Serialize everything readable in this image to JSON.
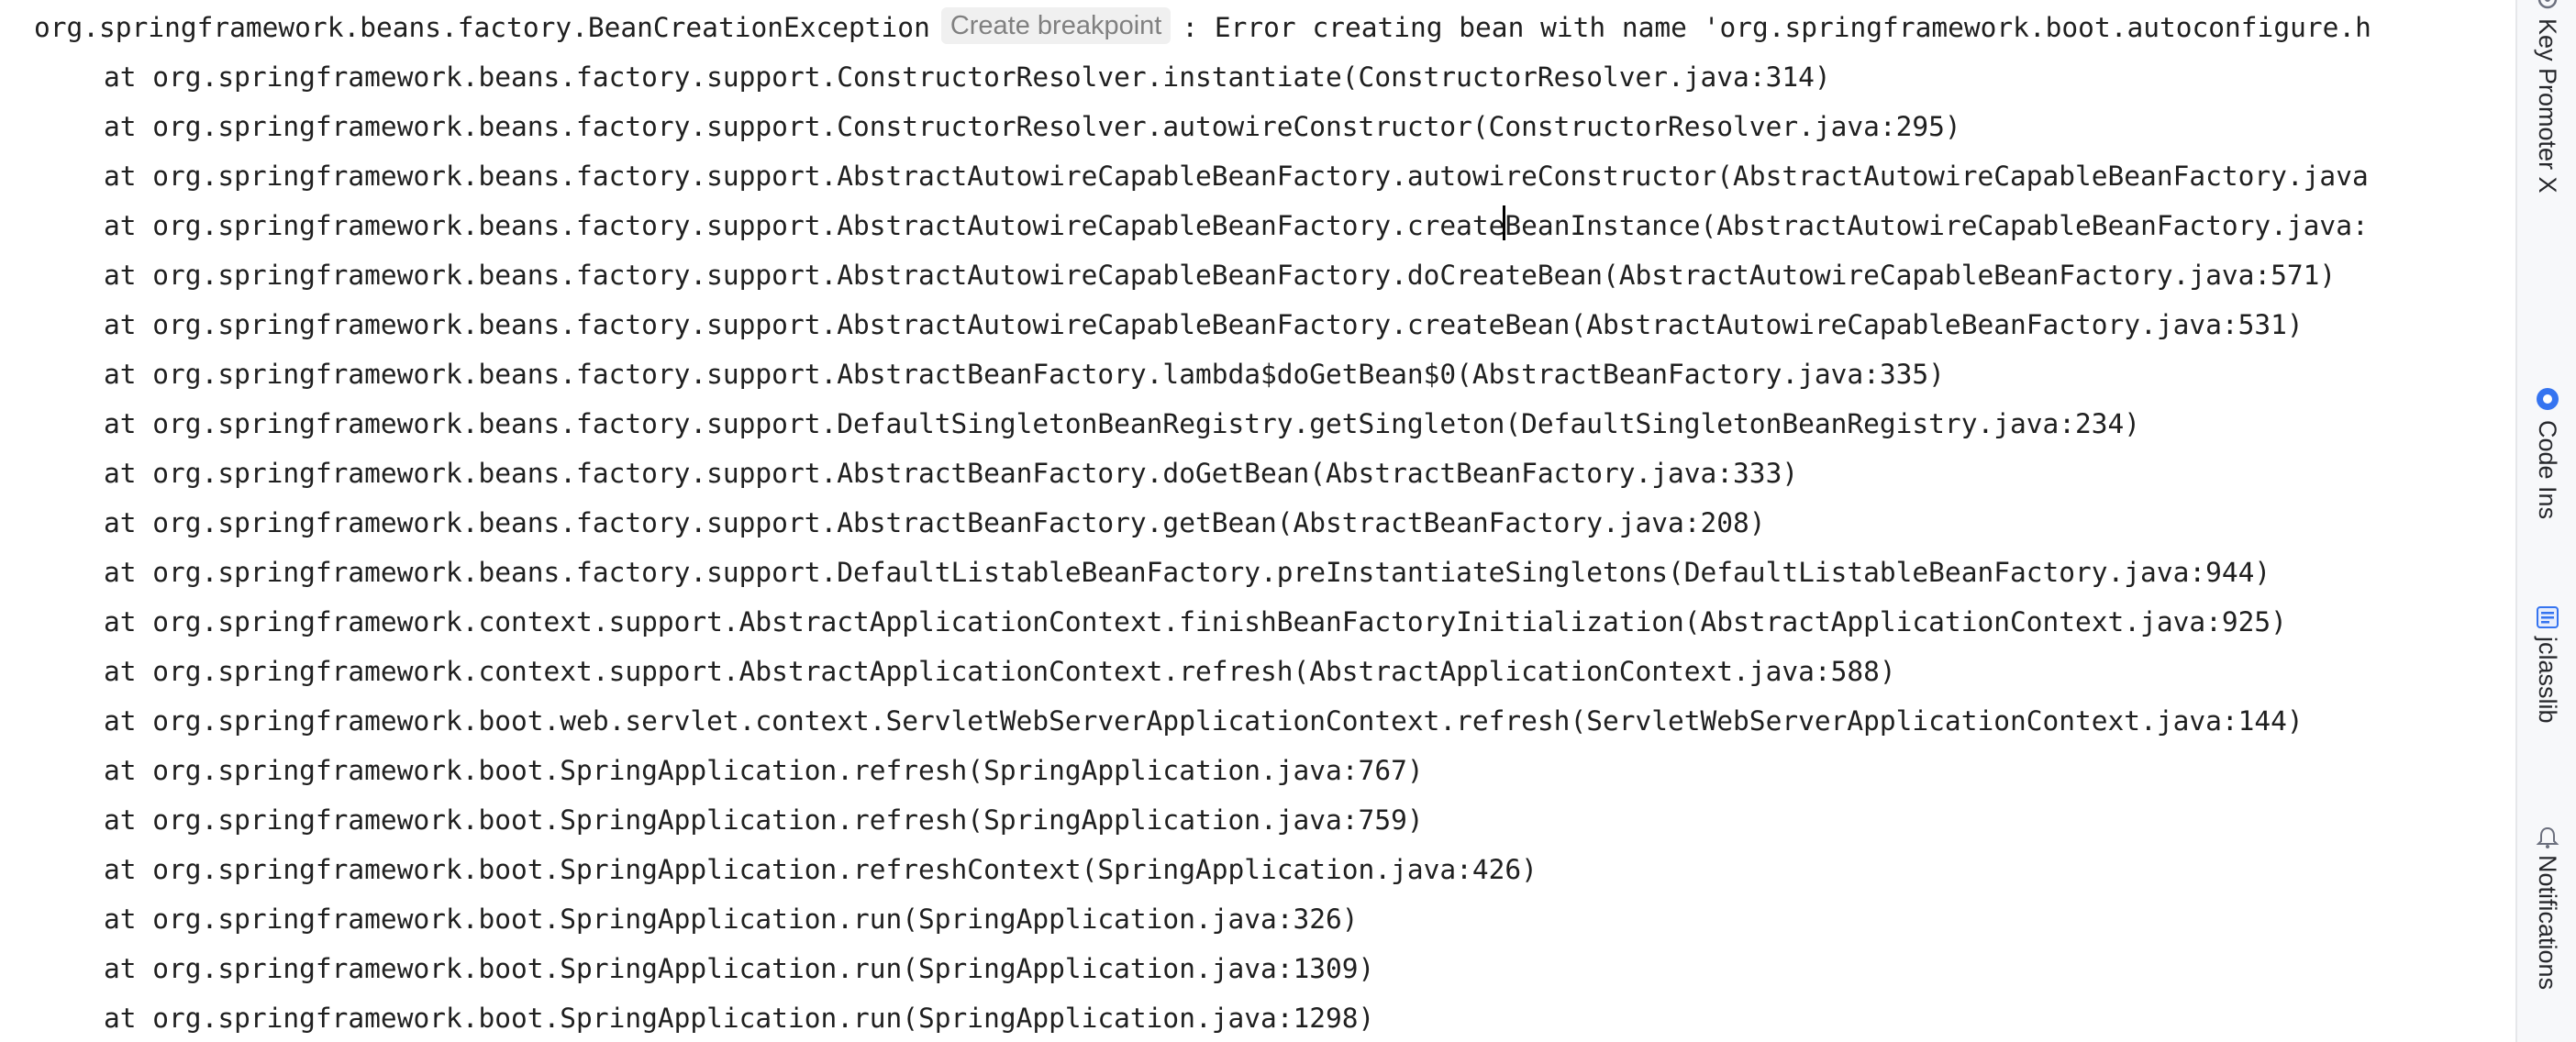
{
  "console": {
    "first_line": {
      "prefix": "org.springframework.beans.factory.BeanCreationException",
      "hint": "Create breakpoint",
      "suffix": ": Error creating bean with name 'org.springframework.boot.autoconfigure.h"
    },
    "frames": [
      "at org.springframework.beans.factory.support.ConstructorResolver.instantiate(ConstructorResolver.java:314)",
      "at org.springframework.beans.factory.support.ConstructorResolver.autowireConstructor(ConstructorResolver.java:295)",
      "at org.springframework.beans.factory.support.AbstractAutowireCapableBeanFactory.autowireConstructor(AbstractAutowireCapableBeanFactory.java",
      "at org.springframework.beans.factory.support.AbstractAutowireCapableBeanFactory.createBeanInstance(AbstractAutowireCapableBeanFactory.java:",
      "at org.springframework.beans.factory.support.AbstractAutowireCapableBeanFactory.doCreateBean(AbstractAutowireCapableBeanFactory.java:571)",
      "at org.springframework.beans.factory.support.AbstractAutowireCapableBeanFactory.createBean(AbstractAutowireCapableBeanFactory.java:531)",
      "at org.springframework.beans.factory.support.AbstractBeanFactory.lambda$doGetBean$0(AbstractBeanFactory.java:335)",
      "at org.springframework.beans.factory.support.DefaultSingletonBeanRegistry.getSingleton(DefaultSingletonBeanRegistry.java:234)",
      "at org.springframework.beans.factory.support.AbstractBeanFactory.doGetBean(AbstractBeanFactory.java:333)",
      "at org.springframework.beans.factory.support.AbstractBeanFactory.getBean(AbstractBeanFactory.java:208)",
      "at org.springframework.beans.factory.support.DefaultListableBeanFactory.preInstantiateSingletons(DefaultListableBeanFactory.java:944)",
      "at org.springframework.context.support.AbstractApplicationContext.finishBeanFactoryInitialization(AbstractApplicationContext.java:925)",
      "at org.springframework.context.support.AbstractApplicationContext.refresh(AbstractApplicationContext.java:588)",
      "at org.springframework.boot.web.servlet.context.ServletWebServerApplicationContext.refresh(ServletWebServerApplicationContext.java:144)",
      "at org.springframework.boot.SpringApplication.refresh(SpringApplication.java:767)",
      "at org.springframework.boot.SpringApplication.refresh(SpringApplication.java:759)",
      "at org.springframework.boot.SpringApplication.refreshContext(SpringApplication.java:426)",
      "at org.springframework.boot.SpringApplication.run(SpringApplication.java:326)",
      "at org.springframework.boot.SpringApplication.run(SpringApplication.java:1309)",
      "at org.springframework.boot.SpringApplication.run(SpringApplication.java:1298)"
    ],
    "caret_line_index": 3,
    "caret_char_index": 86
  },
  "right_toolbar": {
    "items": [
      {
        "label": "Key Promoter X",
        "icon": "key-icon"
      },
      {
        "label": "Code Ins",
        "icon": "code-insight-icon"
      },
      {
        "label": "jclasslib",
        "icon": "jclasslib-icon"
      },
      {
        "label": "Notifications",
        "icon": "bell-icon"
      }
    ]
  }
}
